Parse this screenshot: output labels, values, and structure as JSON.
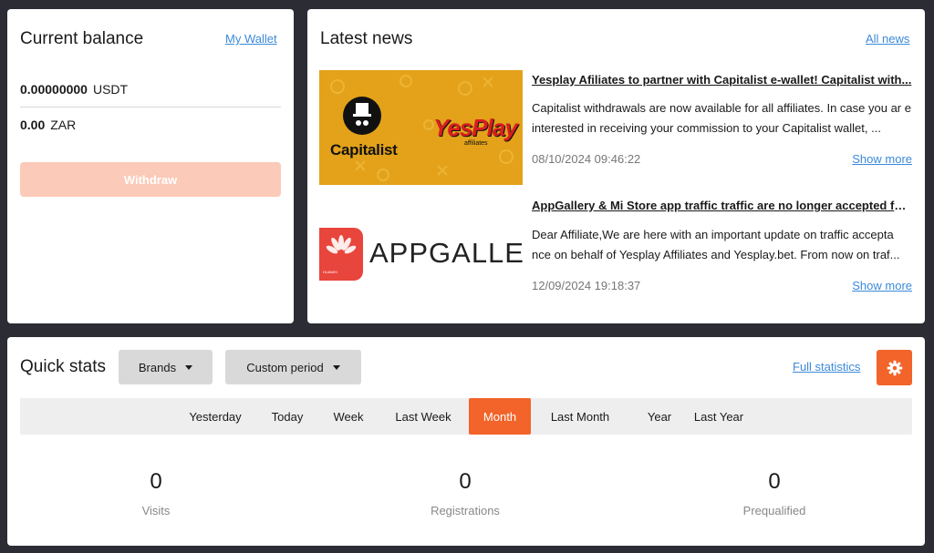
{
  "balance": {
    "title": "Current balance",
    "wallet_link": "My Wallet",
    "rows": [
      {
        "amount": "0.00000000",
        "currency": "USDT"
      },
      {
        "amount": "0.00",
        "currency": "ZAR"
      }
    ],
    "withdraw_label": "Withdraw"
  },
  "news": {
    "title": "Latest news",
    "all_link": "All news",
    "items": [
      {
        "title": "Yesplay Afiliates to partner with Capitalist e-wallet!  Capitalist with...",
        "body": "Capitalist withdrawals are now available for all affiliates. In case you ar e interested in receiving your commission to your Capitalist wallet, ...",
        "date": "08/10/2024 09:46:22",
        "more": "Show more",
        "image_text_left": "Capitalist",
        "image_text_right": "YesPlay",
        "image_text_small": "affiliates"
      },
      {
        "title": "AppGallery & Mi Store app traffic traffic are no longer accepted for ...",
        "body": "Dear Affiliate,We are here with an important update on traffic accepta nce on behalf of Yesplay Affiliates and Yesplay.bet. From now on traf...",
        "date": "12/09/2024 19:18:37",
        "more": "Show more",
        "image_text_left": "HUAWEI",
        "image_text_right": "APPGALLERY"
      }
    ]
  },
  "stats": {
    "title": "Quick stats",
    "brands_label": "Brands",
    "period_label": "Custom period",
    "full_link": "Full statistics",
    "periods": [
      "Yesterday",
      "Today",
      "Week",
      "Last Week",
      "Month",
      "Last Month",
      "Year",
      "Last Year"
    ],
    "active_period": "Month",
    "metrics": [
      {
        "value": "0",
        "label": "Visits"
      },
      {
        "value": "0",
        "label": "Registrations"
      },
      {
        "value": "0",
        "label": "Prequalified"
      }
    ]
  },
  "colors": {
    "accent": "#f2642a",
    "link": "#3b8ad9",
    "background": "#2c2c35"
  }
}
